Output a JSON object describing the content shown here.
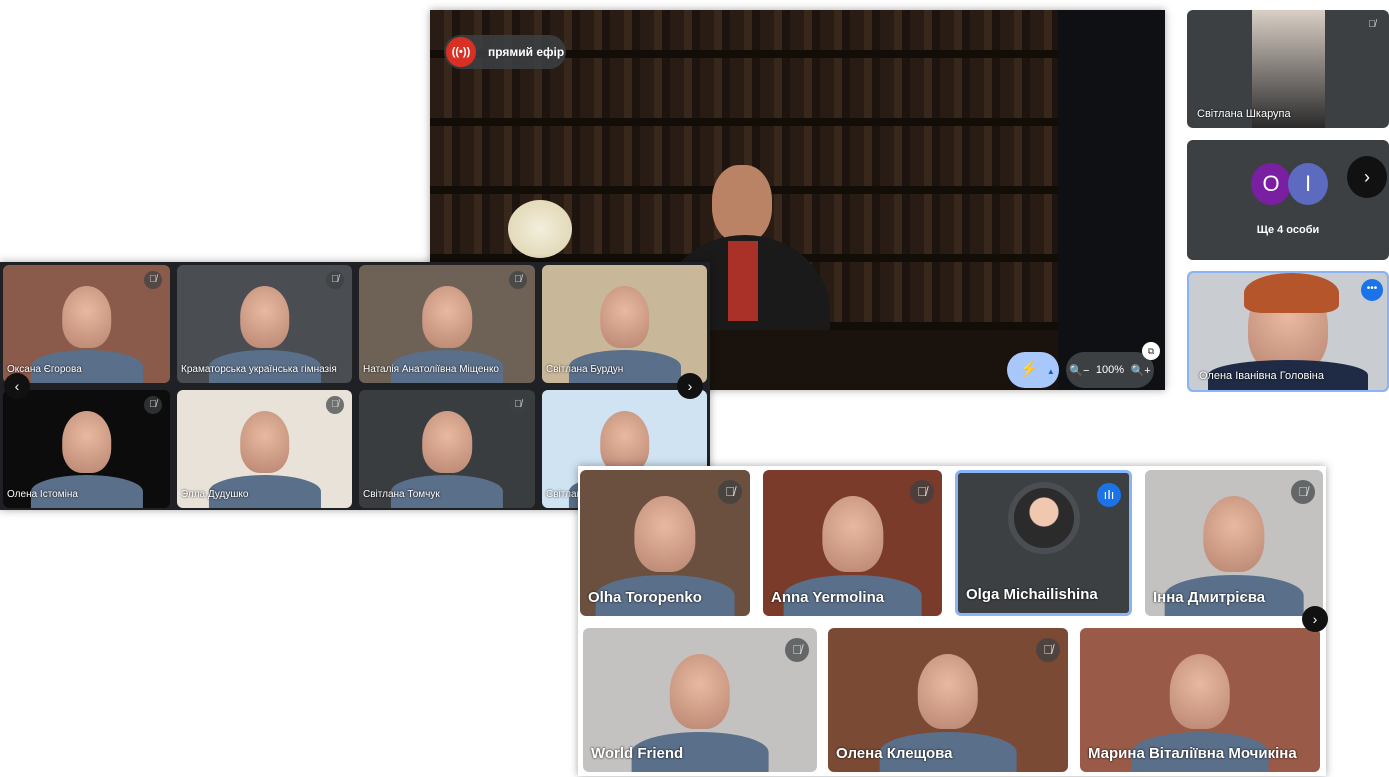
{
  "stream": {
    "live_label": "прямий ефір",
    "zoom_level": "100%"
  },
  "sidebar": {
    "tiles": [
      {
        "name": "Світлана Шкарупа"
      },
      {
        "more_label": "Ще 4 особи",
        "avatars": [
          {
            "letter": "O",
            "color": "#7b1fa2"
          },
          {
            "letter": "I",
            "color": "#5c6bc0"
          }
        ]
      },
      {
        "name": "Олена Іванівна Головіна"
      }
    ]
  },
  "grid_top": {
    "participants": [
      "Оксана Єгорова",
      "Краматорська українська гімназія",
      "Наталія Анатоліївна Міщенко",
      "Світлана Бурдун",
      "Олена Істоміна",
      "Элла Дудушко",
      "Світлана Томчук",
      "Світлана Юріївна Гарна"
    ]
  },
  "grid_bottom": {
    "participants": [
      "Olha Toropenko",
      "Anna Yermolina",
      "Olga Michailishina",
      "Інна Дмитрієва",
      "World Friend",
      "Олена Клещова",
      "Марина Віталіївна Мочикіна"
    ]
  },
  "colors": {
    "accent": "#1a73e8",
    "live": "#d93025",
    "tile": "#3c4043"
  }
}
